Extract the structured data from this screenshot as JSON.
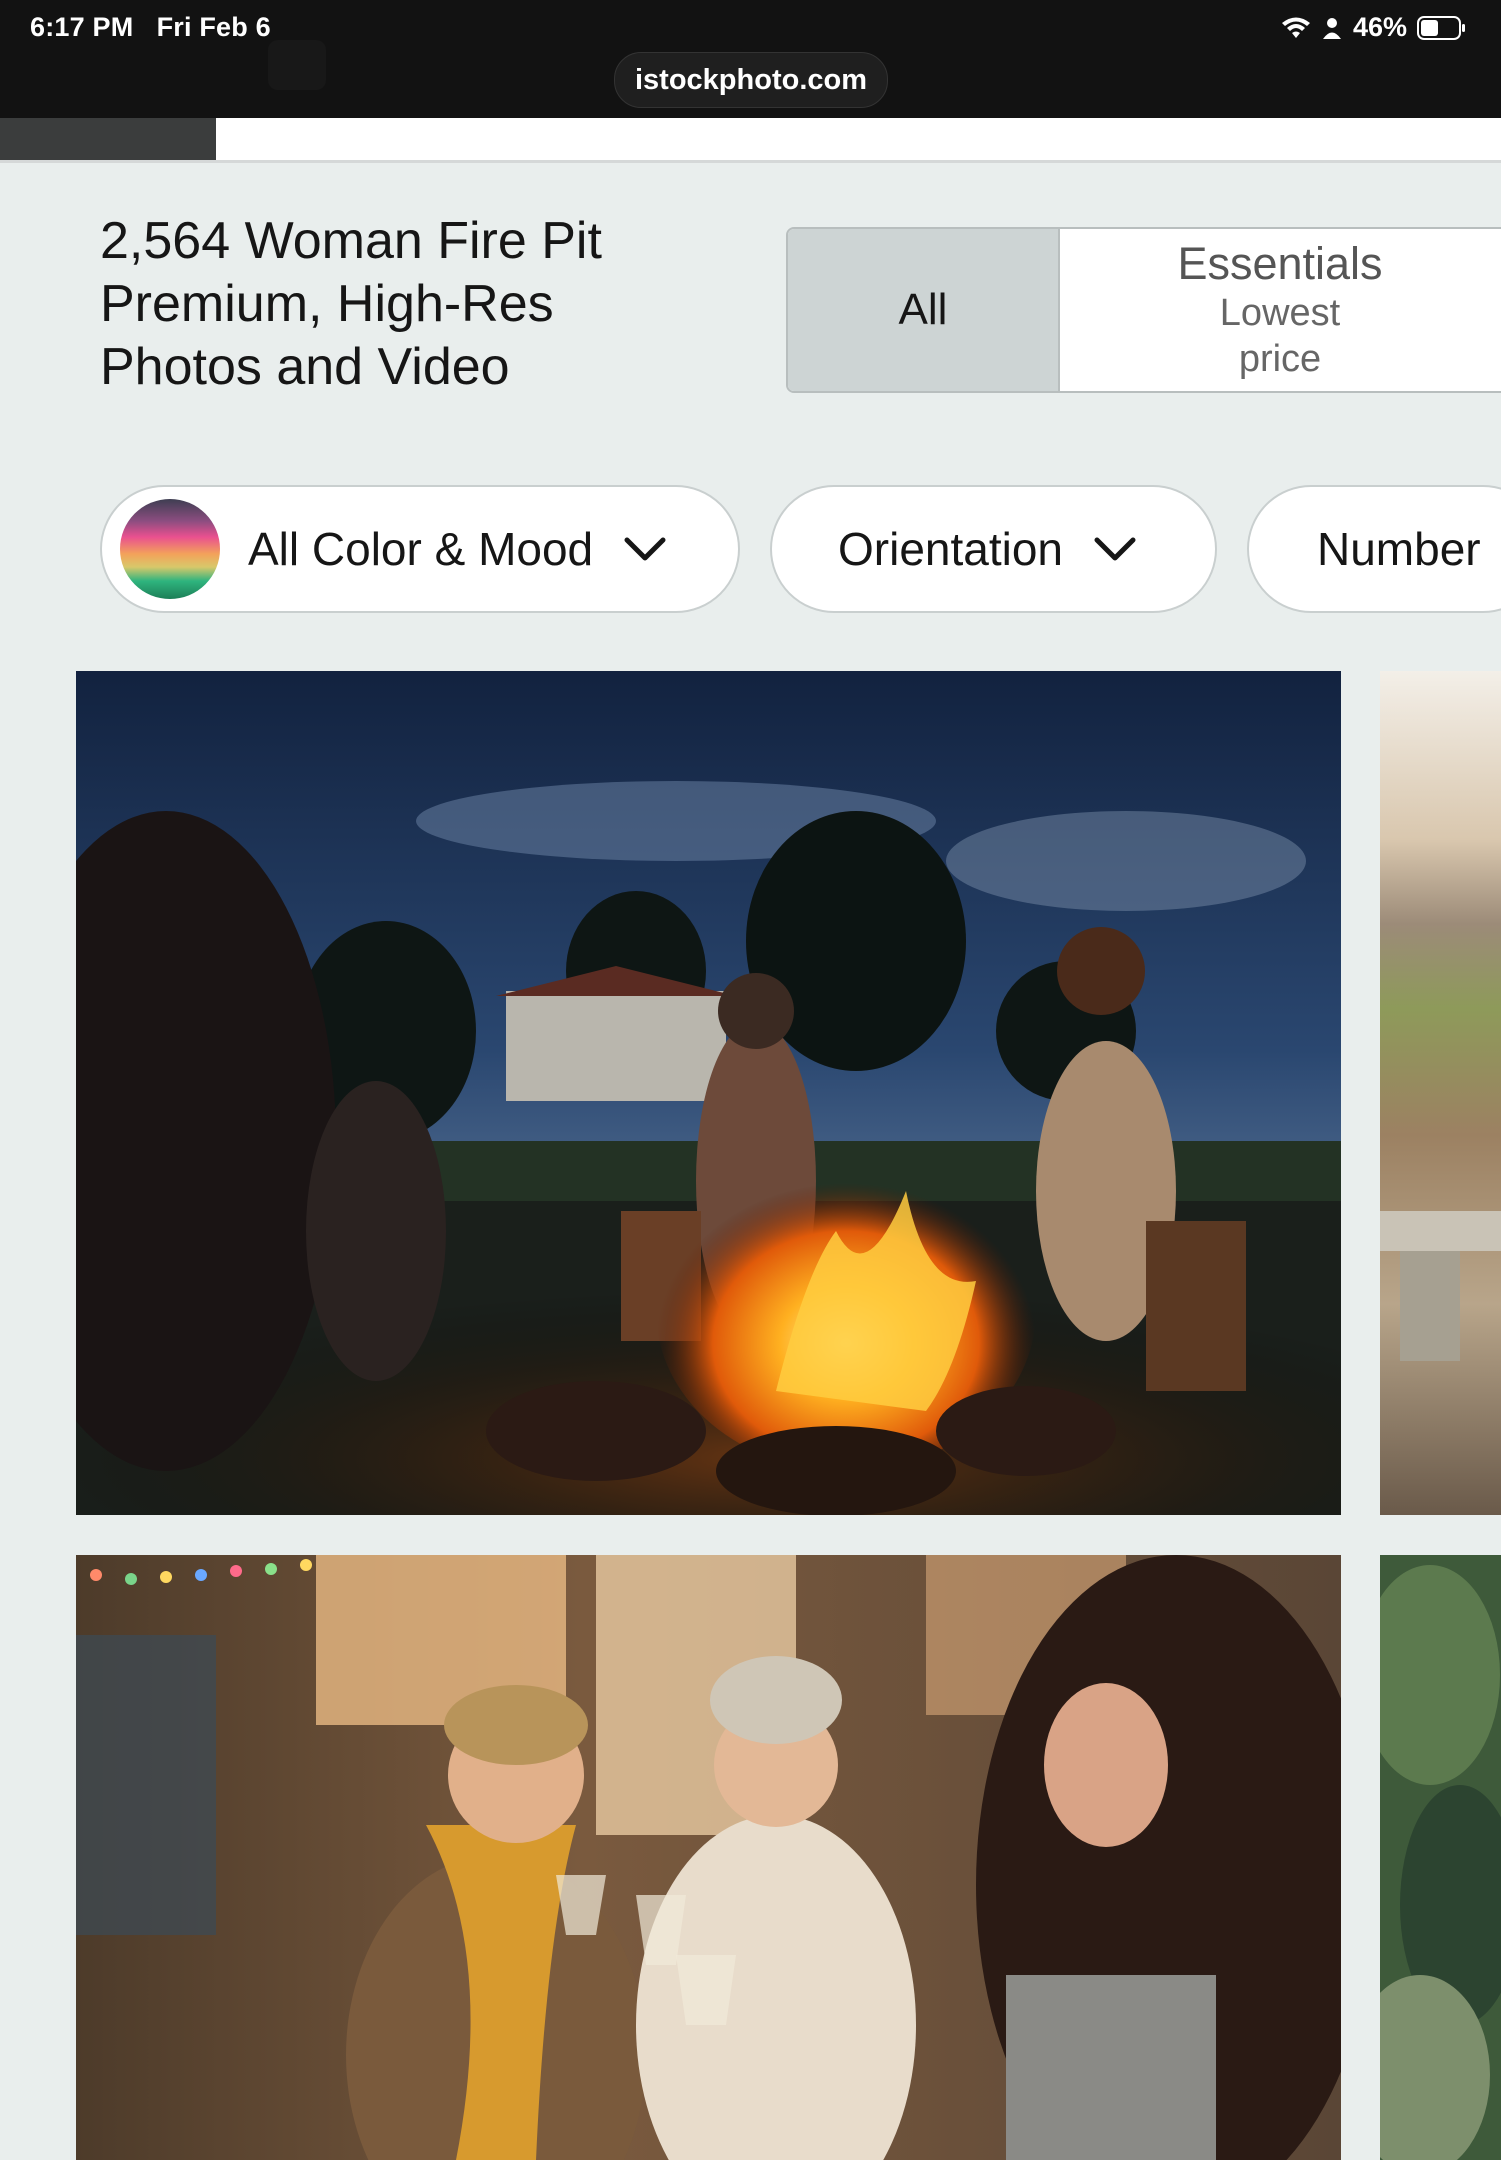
{
  "status_bar": {
    "time": "6:17 PM",
    "date": "Fri Feb 6",
    "battery": "46%",
    "url": "istockphoto.com",
    "icons": [
      "wifi-icon",
      "person-icon",
      "battery-icon"
    ]
  },
  "header": {
    "title": "2,564 Woman Fire Pit Premium, High-Res Photos and Video"
  },
  "license_toggle": {
    "all_label": "All",
    "essentials_label": "Essentials",
    "essentials_sub": "Lowest price",
    "selected": "All"
  },
  "filters": {
    "color_mood": "All Color & Mood",
    "orientation": "Orientation",
    "number": "Number"
  },
  "photos": [
    {
      "subject": "women-around-campfire-at-dusk"
    },
    {
      "subject": "landscape-partial"
    },
    {
      "subject": "women-toasting-wine-outdoors"
    },
    {
      "subject": "greenery-partial"
    }
  ],
  "colors": {
    "page_bg": "#e9eeed",
    "status_bg": "#121212",
    "toggle_selected": "#cdd4d4"
  }
}
